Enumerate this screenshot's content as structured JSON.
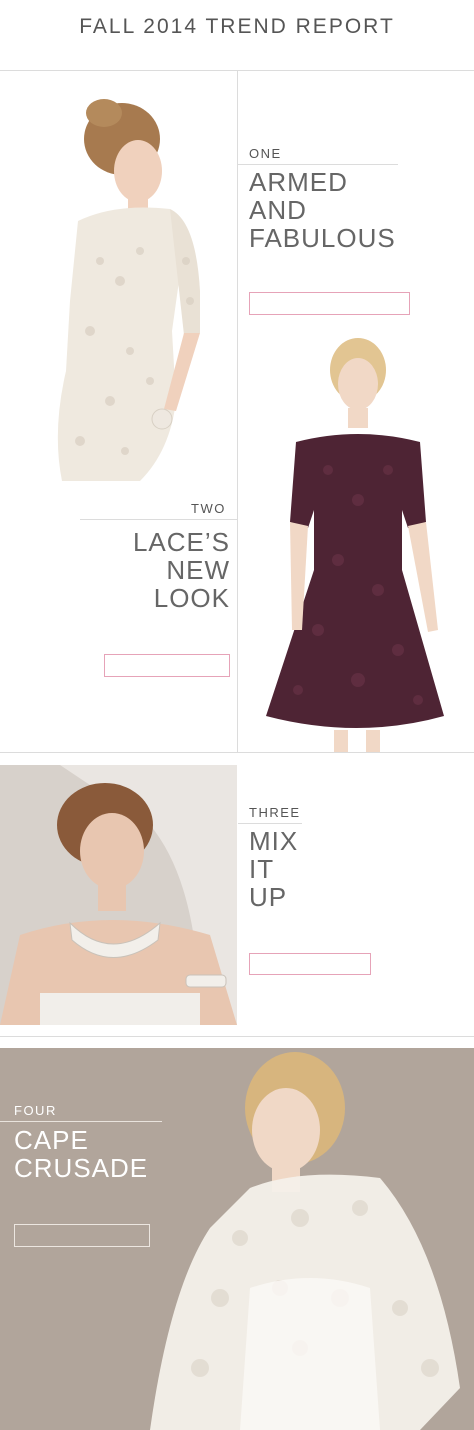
{
  "page": {
    "title": "FALL 2014 TREND REPORT"
  },
  "trends": [
    {
      "number": "ONE",
      "heading": [
        "ARMED",
        "AND",
        "FABULOUS"
      ]
    },
    {
      "number": "TWO",
      "heading": [
        "LACE’S",
        "NEW",
        "LOOK"
      ]
    },
    {
      "number": "THREE",
      "heading": [
        "MIX",
        "IT",
        "UP"
      ]
    },
    {
      "number": "FOUR",
      "heading": [
        "CAPE",
        "CRUSADE"
      ]
    }
  ],
  "colors": {
    "button_border": "#e6a3b8",
    "burgundy_dress": "#4e2434",
    "cape_bg": "#b1a59b"
  }
}
